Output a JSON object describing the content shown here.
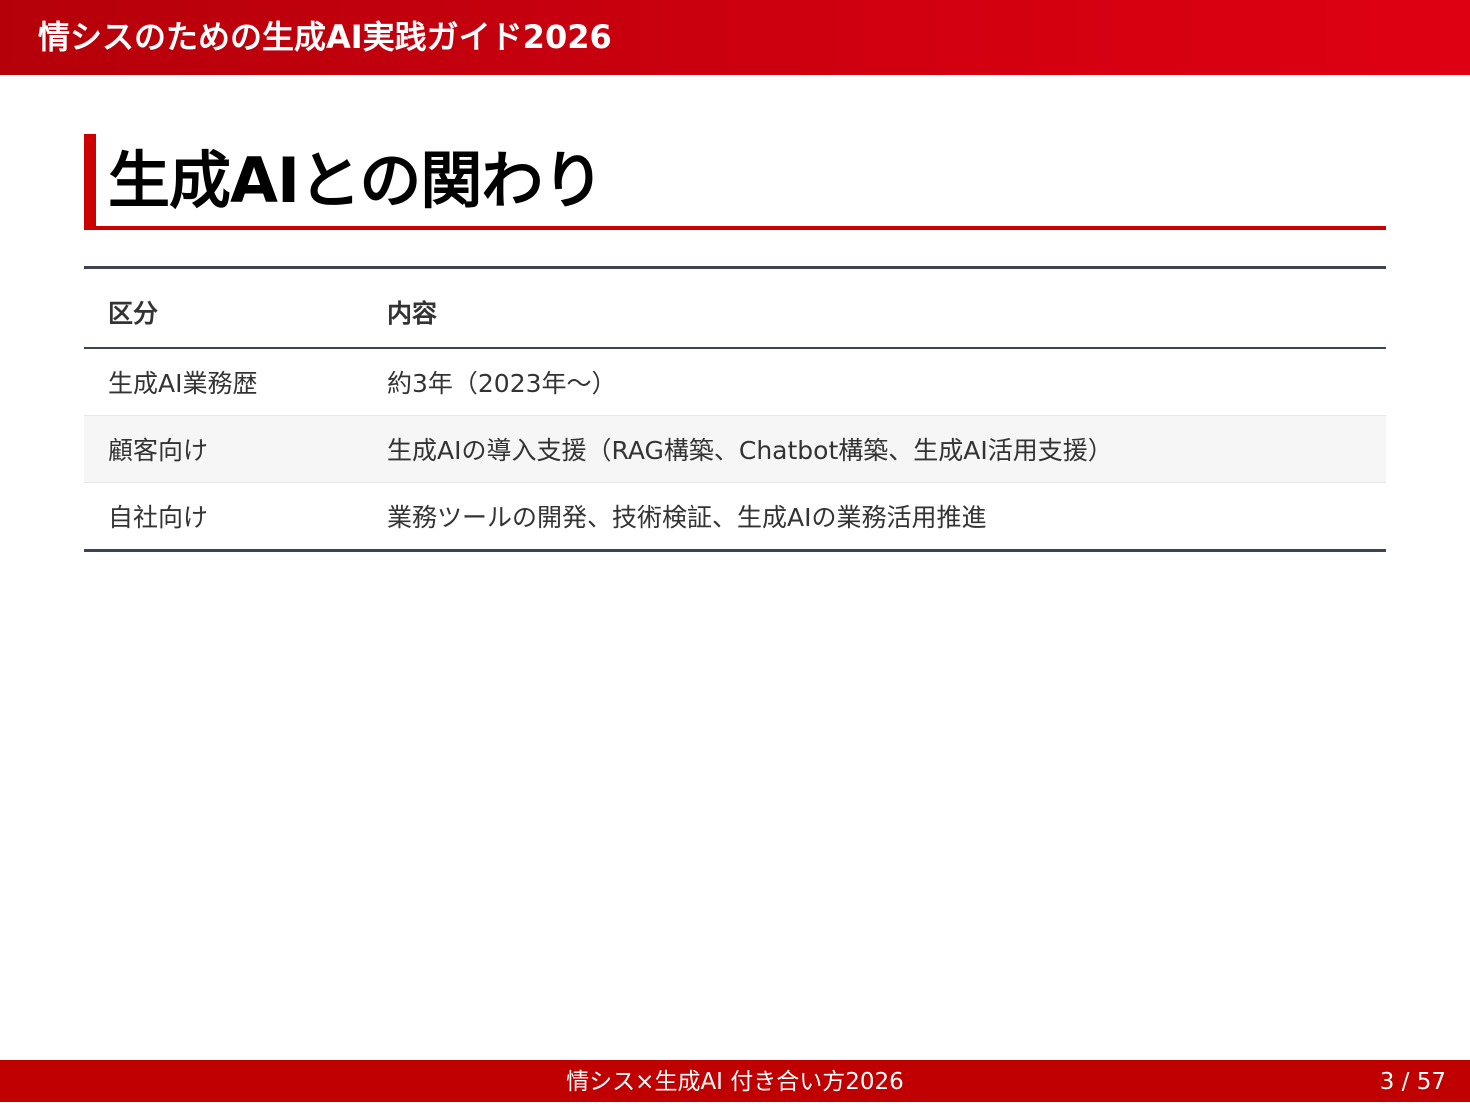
{
  "header": {
    "title": "情シスのための生成AI実践ガイド2026"
  },
  "slide": {
    "title": "生成AIとの関わり"
  },
  "table": {
    "columns": [
      "区分",
      "内容"
    ],
    "rows": [
      [
        "生成AI業務歴",
        "約3年（2023年〜）"
      ],
      [
        "顧客向け",
        "生成AIの導入支援（RAG構築、Chatbot構築、生成AI活用支援）"
      ],
      [
        "自社向け",
        "業務ツールの開発、技術検証、生成AIの業務活用推進"
      ]
    ]
  },
  "footer": {
    "title": "情シス×生成AI 付き合い方2026",
    "page_counter": "3 / 57"
  },
  "colors": {
    "accent": "#cc0000",
    "header_gradient_start": "#b5000a",
    "header_gradient_end": "#de0012",
    "footer": "#c00000",
    "table_rule": "#3d4451",
    "stripe": "#f6f6f6"
  }
}
